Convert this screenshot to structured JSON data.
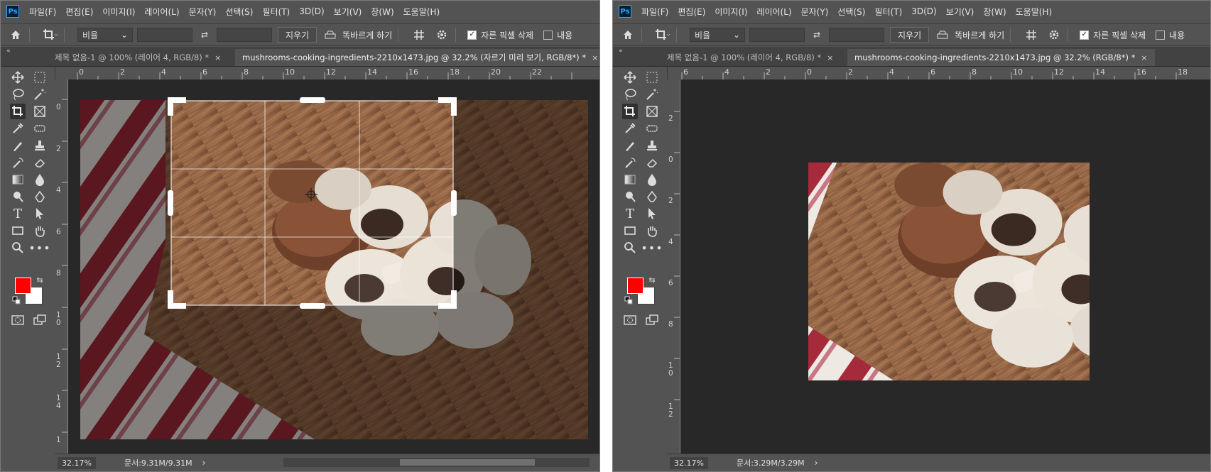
{
  "menu": [
    "파일(F)",
    "편집(E)",
    "이미지(I)",
    "레이어(L)",
    "문자(Y)",
    "선택(S)",
    "필터(T)",
    "3D(D)",
    "보기(V)",
    "창(W)",
    "도움말(H)"
  ],
  "ps_logo": "Ps",
  "options": {
    "ratio_label": "비율",
    "clear_label": "지우기",
    "straighten_label": "똑바르게 하기",
    "delete_cropped_label": "자른 픽셀 삭제",
    "delete_cropped_checked": true,
    "content_aware_label": "내용",
    "content_aware_checked": false
  },
  "left": {
    "tab1": "제목 없음-1 @ 100% (레이어 4, RGB/8) *",
    "tab2": "mushrooms-cooking-ingredients-2210x1473.jpg @ 32.2% (자르기 미리 보기, RGB/8*) *",
    "zoom": "32.17%",
    "doc": "문서:9.31M/9.31M",
    "ruler_h": [
      "0",
      "2",
      "4",
      "6",
      "8",
      "10",
      "12",
      "14",
      "16",
      "18",
      "20",
      "22"
    ],
    "ruler_v": [
      "0",
      "2",
      "4",
      "6",
      "8",
      "1\n0",
      "1\n2",
      "1\n4",
      "1\n"
    ]
  },
  "right": {
    "tab1": "제목 없음-1 @ 100% (레이어 4, RGB/8) *",
    "tab2": "mushrooms-cooking-ingredients-2210x1473.jpg @ 32.2% (RGB/8*) *",
    "zoom": "32.17%",
    "doc": "문서:3.29M/3.29M",
    "ruler_h": [
      "6",
      "4",
      "2",
      "0",
      "2",
      "4",
      "6",
      "8",
      "10",
      "12",
      "14",
      "16",
      "18"
    ],
    "ruler_v": [
      "2",
      "0",
      "2",
      "4",
      "6",
      "8",
      "1\n0",
      "1\n2"
    ]
  },
  "colors": {
    "foreground": "#ff0000",
    "background": "#ffffff",
    "ui": "#535353",
    "canvas": "#282828"
  }
}
